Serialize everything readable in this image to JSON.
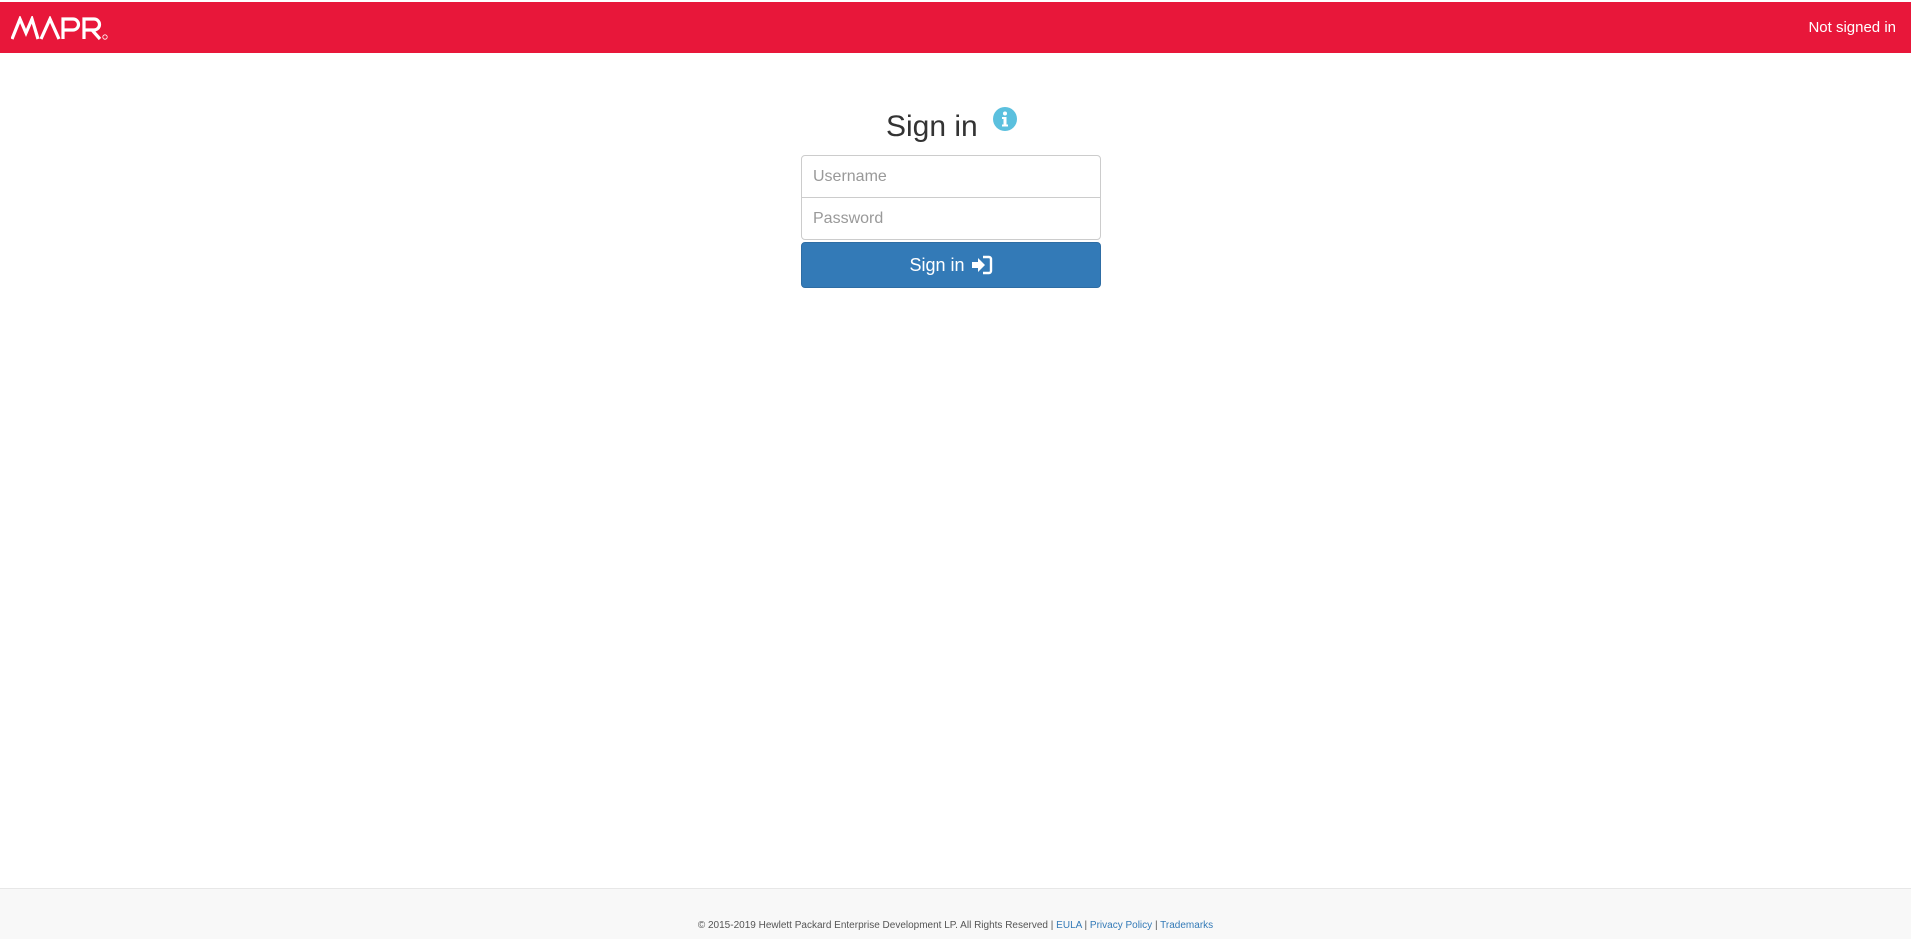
{
  "header": {
    "logo_name": "mapr-logo",
    "status": "Not signed in",
    "color": "#e8173a"
  },
  "signin": {
    "title": "Sign in",
    "info_icon": "info-circle-icon",
    "username_placeholder": "Username",
    "username_value": "",
    "password_placeholder": "Password",
    "password_value": "",
    "button_label": "Sign in",
    "button_icon": "sign-in-icon",
    "button_color": "#337ab7"
  },
  "footer": {
    "copyright": "© 2015-2019 Hewlett Packard Enterprise Development LP. All Rights Reserved",
    "separator": "|",
    "links": [
      "EULA",
      "Privacy Policy",
      "Trademarks"
    ]
  }
}
